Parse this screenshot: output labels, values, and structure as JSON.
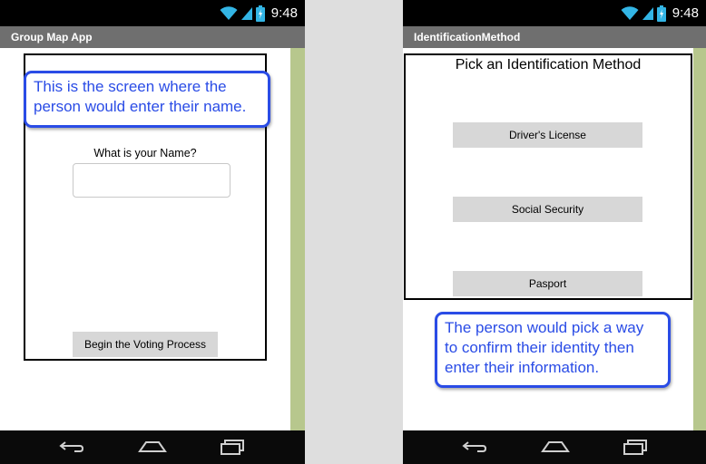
{
  "status_bar": {
    "time": "9:48"
  },
  "left_screen": {
    "app_title": "Group Map App",
    "callout": "This is the screen where the person would enter their name.",
    "name_prompt": "What is your Name?",
    "name_input": {
      "value": "",
      "placeholder": ""
    },
    "begin_button": "Begin the Voting Process"
  },
  "right_screen": {
    "app_title": "IdentificationMethod",
    "heading": "Pick an Identification Method",
    "buttons": [
      "Driver's License",
      "Social Security",
      "Pasport"
    ],
    "callout": "The person would pick a way to confirm their identity then enter their information."
  },
  "colors": {
    "callout_blue": "#2a4ce6",
    "title_bar": "#6f6f6f",
    "green_strip": "#b7c78d",
    "button_gray": "#d7d7d7",
    "wifi_cyan": "#33b5e5"
  },
  "icons": [
    "wifi-icon",
    "signal-icon",
    "battery-icon",
    "back-icon",
    "home-icon",
    "recents-icon"
  ]
}
